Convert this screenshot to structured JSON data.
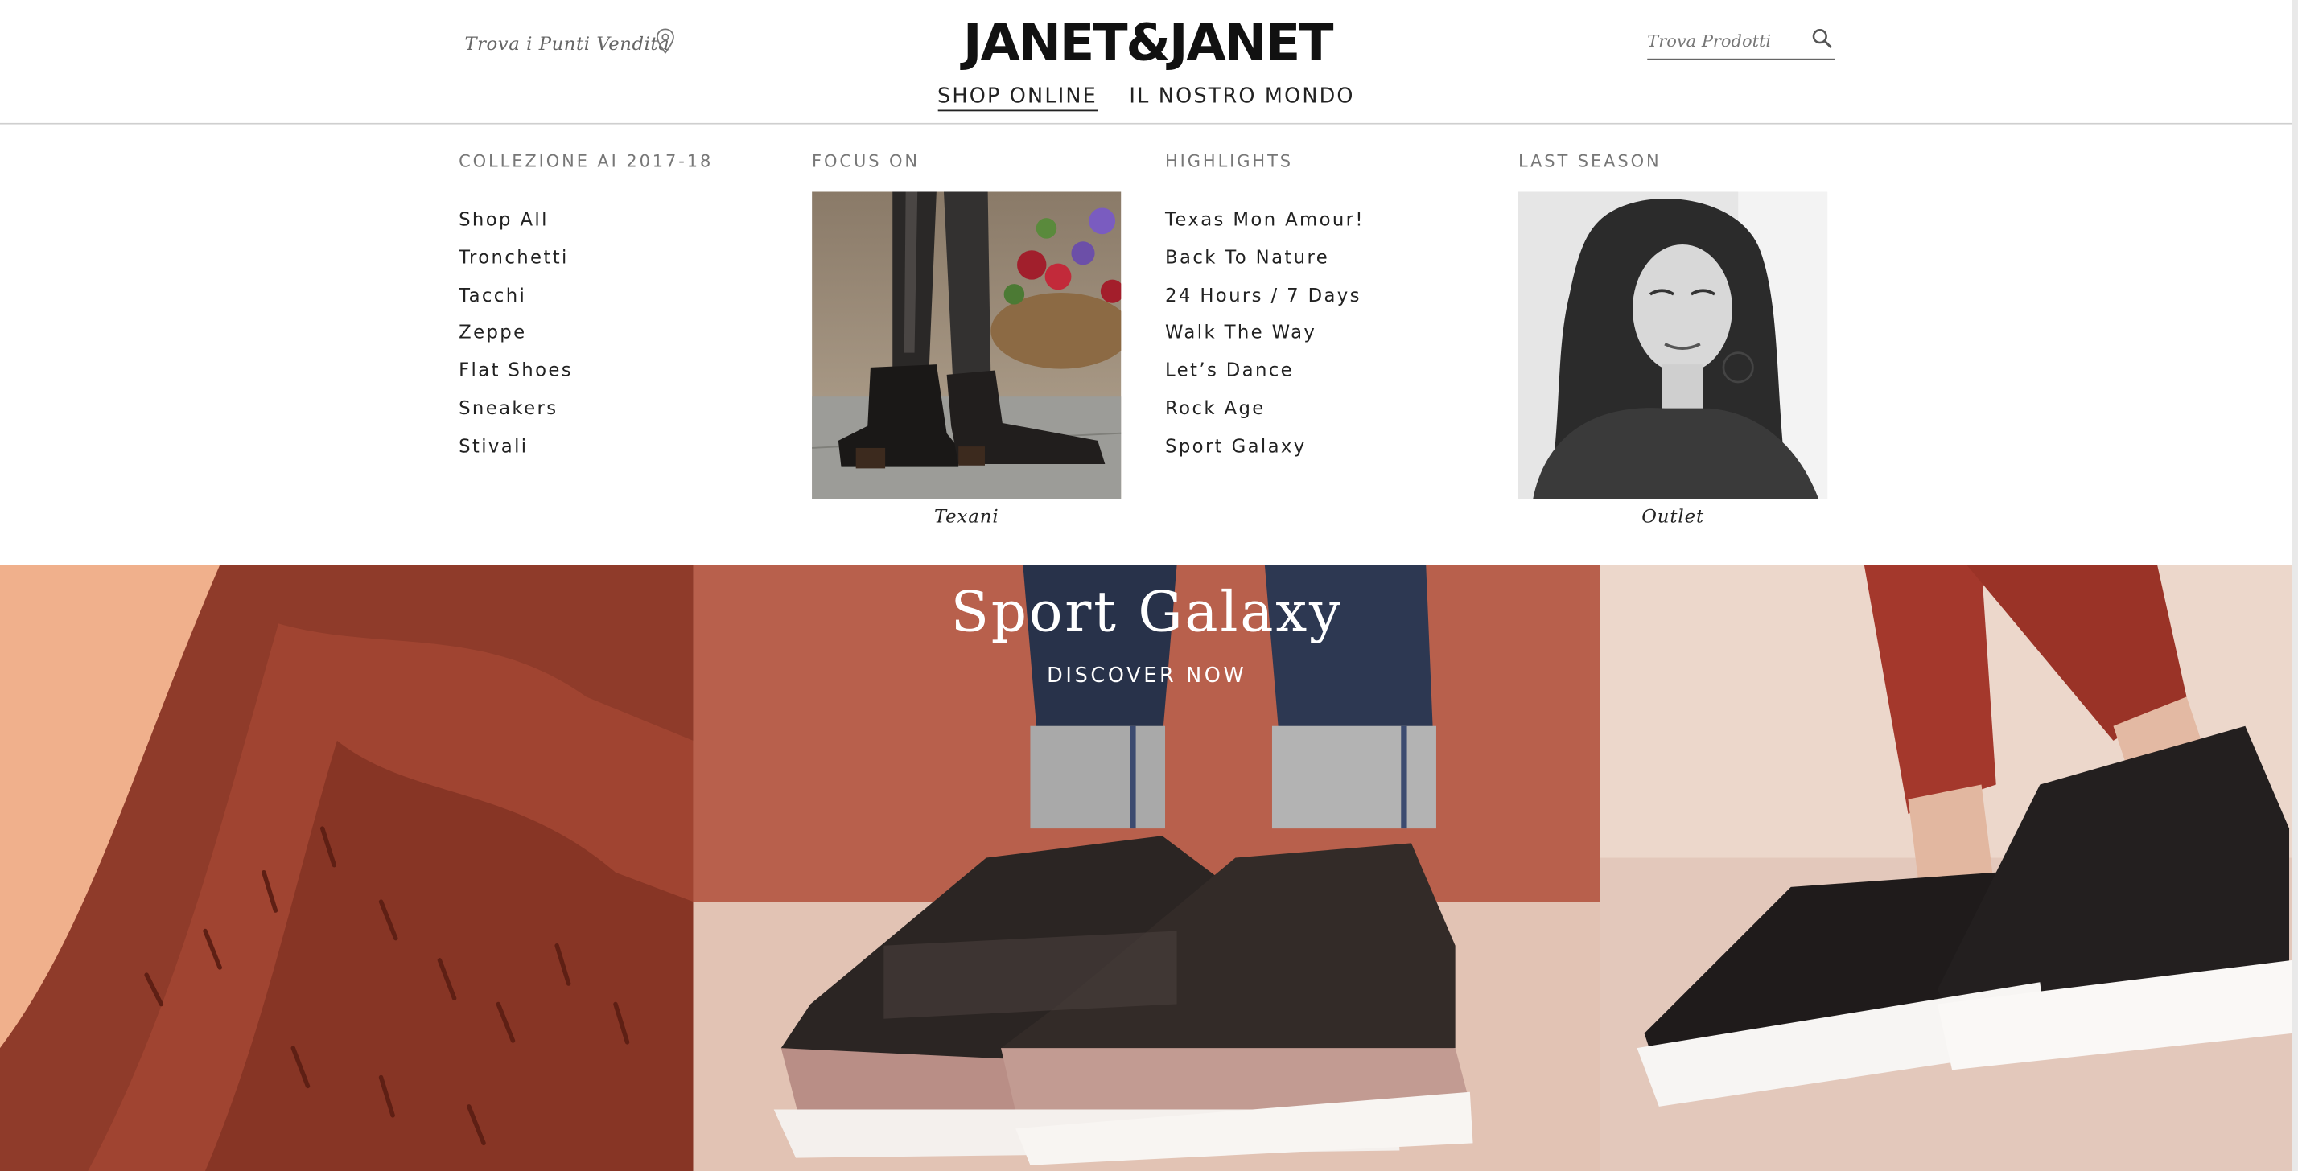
{
  "header": {
    "stores_link": "Trova i Punti Vendita",
    "logo": "JANET&JANET",
    "search_placeholder": "Trova Prodotti"
  },
  "main_nav": [
    {
      "label": "SHOP ONLINE",
      "active": true
    },
    {
      "label": "IL NOSTRO MONDO",
      "active": false
    }
  ],
  "mega_menu": {
    "collection": {
      "title": "COLLEZIONE AI 2017-18",
      "items": [
        "Shop All",
        "Tronchetti",
        "Tacchi",
        "Zeppe",
        "Flat Shoes",
        "Sneakers",
        "Stivali"
      ]
    },
    "focus": {
      "title": "FOCUS ON",
      "caption": "Texani"
    },
    "highlights": {
      "title": "HIGHLIGHTS",
      "items": [
        "Texas Mon Amour!",
        "Back To Nature",
        "24 Hours / 7 Days",
        "Walk The Way",
        "Let’s Dance",
        "Rock Age",
        "Sport Galaxy"
      ]
    },
    "last_season": {
      "title": "LAST SEASON",
      "caption": "Outlet"
    }
  },
  "hero": {
    "title": "Sport Galaxy",
    "cta": "DISCOVER NOW"
  },
  "colors": {
    "text": "#222222",
    "muted": "#777777",
    "hero_left_bg": "#f0b08c",
    "hero_center_bg": "#b8604c",
    "hero_right_bg": "#e3c8bb"
  },
  "icons": {
    "store_locator": "map-pin-icon",
    "search": "search-icon"
  }
}
